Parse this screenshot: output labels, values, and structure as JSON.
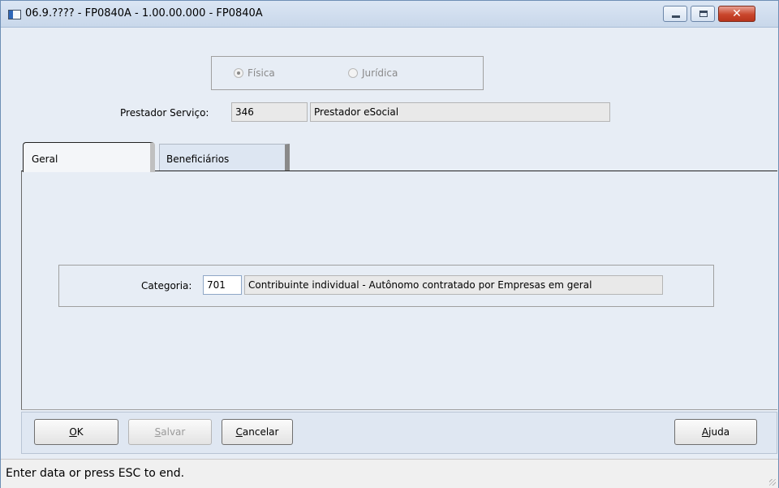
{
  "window": {
    "title": "06.9.???? - FP0840A - 1.00.00.000 - FP0840A",
    "minimize_icon": "minimize-icon",
    "maximize_icon": "maximize-icon",
    "close_icon": "close-icon",
    "close_glyph": "✕"
  },
  "person_type": {
    "options": [
      {
        "label": "Física",
        "selected": true
      },
      {
        "label": "Jurídica",
        "selected": false
      }
    ]
  },
  "prestador": {
    "label": "Prestador Serviço:",
    "code": "346",
    "name": "Prestador eSocial"
  },
  "tabs": [
    {
      "label": "Geral",
      "active": true
    },
    {
      "label": "Beneficiários",
      "active": false
    }
  ],
  "categoria": {
    "label": "Categoria:",
    "code": "701",
    "description": "Contribuinte individual - Autônomo contratado por Empresas em geral"
  },
  "buttons": {
    "ok": {
      "mnemonic": "O",
      "rest": "K"
    },
    "salvar": {
      "mnemonic": "S",
      "rest": "alvar"
    },
    "cancelar": {
      "mnemonic": "C",
      "rest": "ancelar"
    },
    "ajuda": {
      "mnemonic": "A",
      "rest": "juda"
    }
  },
  "status": {
    "text": "Enter data or press ESC to end."
  }
}
